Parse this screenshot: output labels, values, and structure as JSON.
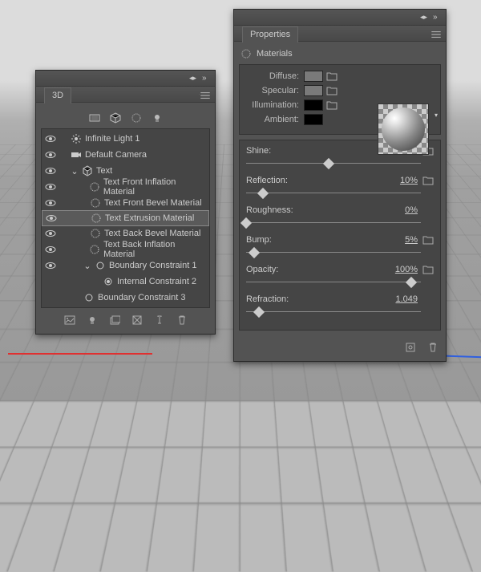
{
  "panel3d": {
    "title": "3D",
    "tree": [
      {
        "icon": "light",
        "label": "Infinite Light 1",
        "indent": 10,
        "eye": true
      },
      {
        "icon": "camera",
        "label": "Default Camera",
        "indent": 10,
        "eye": true
      },
      {
        "icon": "mesh",
        "label": "Text",
        "indent": 10,
        "eye": true,
        "caret": "v"
      },
      {
        "icon": "mat",
        "label": "Text Front Inflation Material",
        "indent": 34,
        "eye": true
      },
      {
        "icon": "mat",
        "label": "Text Front Bevel Material",
        "indent": 34,
        "eye": true
      },
      {
        "icon": "mat",
        "label": "Text Extrusion Material",
        "indent": 34,
        "eye": true,
        "sel": true
      },
      {
        "icon": "mat",
        "label": "Text Back Bevel Material",
        "indent": 34,
        "eye": true
      },
      {
        "icon": "mat",
        "label": "Text Back Inflation Material",
        "indent": 34,
        "eye": true
      },
      {
        "icon": "circ",
        "label": "Boundary Constraint 1",
        "indent": 26,
        "eye": true,
        "caret": "v"
      },
      {
        "icon": "disc",
        "label": "Internal Constraint 2",
        "indent": 50,
        "eye": false
      },
      {
        "icon": "circ",
        "label": "Boundary Constraint 3",
        "indent": 26,
        "eye": false
      }
    ]
  },
  "props": {
    "title": "Properties",
    "subtitle": "Materials",
    "swatches": {
      "diffuse": {
        "label": "Diffuse:",
        "color": "#7a7a7a"
      },
      "specular": {
        "label": "Specular:",
        "color": "#7a7a7a"
      },
      "illumination": {
        "label": "Illumination:",
        "color": "#000"
      },
      "ambient": {
        "label": "Ambient:",
        "color": "#000"
      }
    },
    "sliders": {
      "shine": {
        "label": "Shine:",
        "value": "50%",
        "pos": 50,
        "folder": true
      },
      "reflection": {
        "label": "Reflection:",
        "value": "10%",
        "pos": 10,
        "folder": true
      },
      "roughness": {
        "label": "Roughness:",
        "value": "0%",
        "pos": 0
      },
      "bump": {
        "label": "Bump:",
        "value": "5%",
        "pos": 5,
        "folder": true
      },
      "opacity": {
        "label": "Opacity:",
        "value": "100%",
        "pos": 100,
        "folder": true
      },
      "refraction": {
        "label": "Refraction:",
        "value": "1.049",
        "pos": 8
      }
    }
  }
}
